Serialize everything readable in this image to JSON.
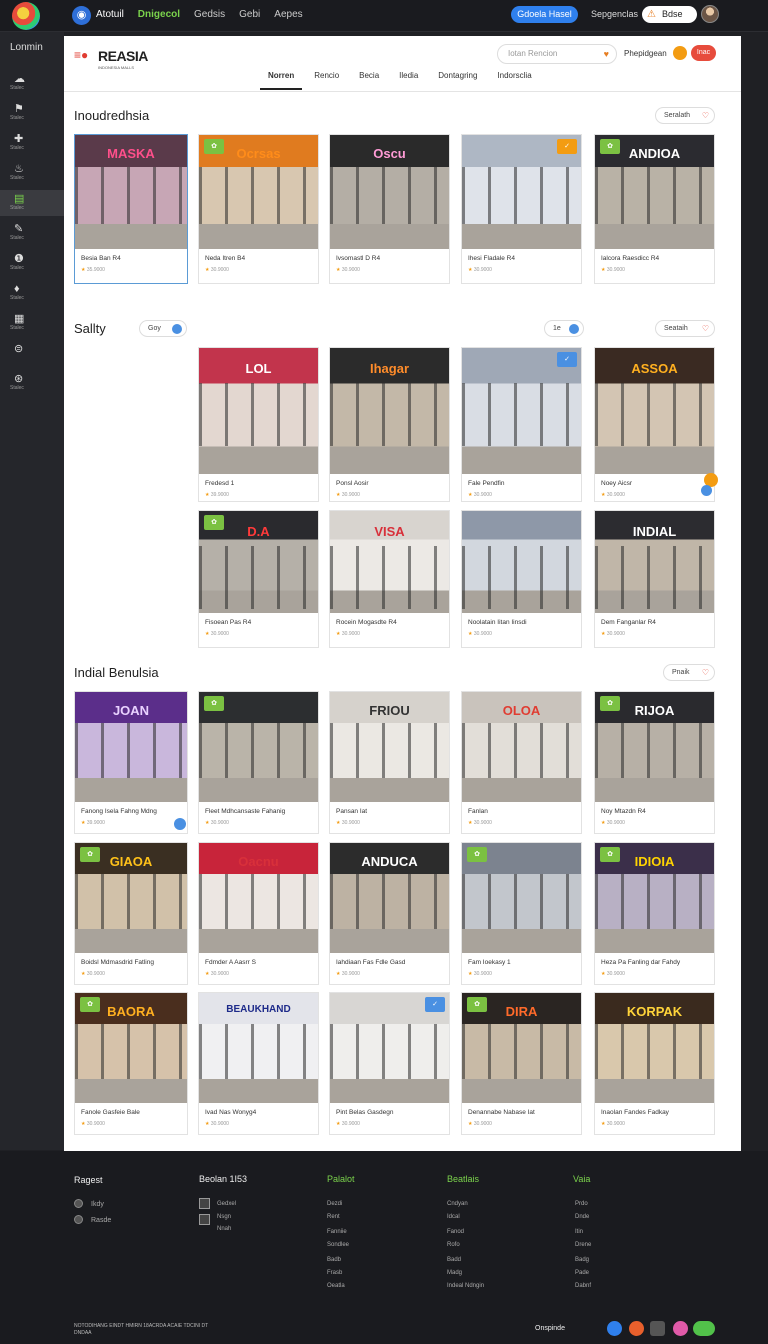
{
  "topbar": {
    "nav": [
      "Atotuil",
      "Dnigecol",
      "Gedsis",
      "Gebi",
      "Aepes"
    ],
    "active_index": 1,
    "cta": "Gdoela Hasel",
    "link": "Sepgenclas",
    "account": "Bdse"
  },
  "sidebar": {
    "title": "Lonmin",
    "items": [
      {
        "icon": "☁",
        "label": "Stalec"
      },
      {
        "icon": "⚑",
        "label": "Stalec"
      },
      {
        "icon": "✚",
        "label": "Stalec"
      },
      {
        "icon": "♨",
        "label": "Stalec"
      },
      {
        "icon": "▤",
        "label": "Stalec"
      },
      {
        "icon": "✎",
        "label": "Stalec"
      },
      {
        "icon": "❶",
        "label": "Stalec"
      },
      {
        "icon": "♦",
        "label": "Stalec"
      },
      {
        "icon": "▦",
        "label": "Stalec"
      },
      {
        "icon": "⊜",
        "label": ""
      },
      {
        "icon": "⊛",
        "label": "Stalec"
      }
    ],
    "active_index": 4
  },
  "header": {
    "brand": "REASIA",
    "brand_tagline": "INDONESIA MALLS",
    "search_placeholder": "Iotan Rencion",
    "link": "Phepidgean",
    "button": "Inac",
    "tabs": [
      "Norren",
      "Rencio",
      "Becia",
      "Iledia",
      "Dontagring",
      "Indorsclia"
    ],
    "active_tab": 0
  },
  "sections": [
    {
      "title": "Inoudredhsia",
      "pill": "Seralath",
      "cards": [
        {
          "title": "Besia Ban R4",
          "sub": "35.9000",
          "sign": "MASKA",
          "sign_color": "#ff4f8b",
          "colors": [
            "#5a3a4a",
            "#c7a6b5"
          ],
          "badge": ""
        },
        {
          "title": "Neda Itren B4",
          "sub": "30.9000",
          "sign": "Ocrsas",
          "sign_color": "#ff8c1a",
          "colors": [
            "#e07b1f",
            "#d8c7b0"
          ],
          "badge": "g"
        },
        {
          "title": "Ivsomastl D R4",
          "sub": "30.9000",
          "sign": "Oscu",
          "sign_color": "#ff9bd6",
          "colors": [
            "#2a2a2a",
            "#b4aea5"
          ],
          "badge": ""
        },
        {
          "title": "Ihesi Fladale R4",
          "sub": "30.9000",
          "sign": "",
          "sign_color": "#fff",
          "colors": [
            "#aeb7c4",
            "#dfe3ea"
          ],
          "badge": "o"
        },
        {
          "title": "Ialcora Raesdicc R4",
          "sub": "30.9000",
          "sign": "ANDIOA",
          "sign_color": "#ffffff",
          "colors": [
            "#2b2b30",
            "#b9b2a6"
          ],
          "badge": "g"
        }
      ]
    },
    {
      "title": "Sallty",
      "pill_left": "Goy",
      "pill_mid": "1e",
      "pill": "Seataih",
      "cards": [
        {
          "title": "Fredesd 1",
          "sub": "39.9000",
          "sign": "LOL",
          "sign_color": "#ffffff",
          "colors": [
            "#c2344c",
            "#e3d7d0"
          ],
          "badge": ""
        },
        {
          "title": "Ponsl Aosir",
          "sub": "30.9000",
          "sign": "Ihagar",
          "sign_color": "#ff8c2a",
          "colors": [
            "#2b2b2b",
            "#c3b8a8"
          ],
          "badge": ""
        },
        {
          "title": "Fale Pendfin",
          "sub": "30.9000",
          "sign": "",
          "sign_color": "#fff",
          "colors": [
            "#9fa8b6",
            "#d9dde4"
          ],
          "badge": "b"
        },
        {
          "title": "Noey Aicsr",
          "sub": "30.9000",
          "sign": "ASSOA",
          "sign_color": "#ffb020",
          "colors": [
            "#3a2a22",
            "#d3c5b3"
          ],
          "badge": ""
        },
        {
          "title": "Fisoean Pas R4",
          "sub": "30.9000",
          "sign": "D.A",
          "sign_color": "#ff3a3a",
          "colors": [
            "#2a2a2e",
            "#b5b0a8"
          ],
          "badge": "g"
        },
        {
          "title": "Rocein Mogasdte R4",
          "sub": "30.9000",
          "sign": "VISA",
          "sign_color": "#d8303a",
          "colors": [
            "#d8d4cf",
            "#ece9e5"
          ],
          "badge": ""
        },
        {
          "title": "Noolatain Iitan Iinsdi",
          "sub": "30.9000",
          "sign": "",
          "sign_color": "#fff",
          "colors": [
            "#8e98a8",
            "#d2d7de"
          ],
          "badge": ""
        },
        {
          "title": "Dem Fanganlar R4",
          "sub": "30.9000",
          "sign": "INDIAL",
          "sign_color": "#ffffff",
          "colors": [
            "#2c2c30",
            "#c0b6a8"
          ],
          "badge": ""
        }
      ]
    },
    {
      "title": "Indial Benulsia",
      "pill": "Pnaik",
      "cards": [
        {
          "title": "Fanong Isela Fahng Mdng",
          "sub": "39.9000",
          "sign": "JOAN",
          "sign_color": "#e9d2ff",
          "colors": [
            "#5b2e8a",
            "#c9b7dc"
          ],
          "badge": ""
        },
        {
          "title": "Fleet Mdhcansaste Fahanig",
          "sub": "30.9000",
          "sign": "",
          "sign_color": "#fff",
          "colors": [
            "#2c2e30",
            "#bab4a9"
          ],
          "badge": "g"
        },
        {
          "title": "Pansan Iat",
          "sub": "30.9000",
          "sign": "FRIOU",
          "sign_color": "#333333",
          "colors": [
            "#d6d2cc",
            "#ebe8e3"
          ],
          "badge": ""
        },
        {
          "title": "Fanlan",
          "sub": "30.9000",
          "sign": "OLOA",
          "sign_color": "#e03c31",
          "colors": [
            "#c9c3bc",
            "#e2ded8"
          ],
          "badge": ""
        },
        {
          "title": "Noy Mtazdn R4",
          "sub": "30.9000",
          "sign": "RIJOA",
          "sign_color": "#ffffff",
          "colors": [
            "#2a2a2e",
            "#b7b0a6"
          ],
          "badge": "g"
        },
        {
          "title": "Boidsl Mdmasdrid Fatling",
          "sub": "30.9000",
          "sign": "GIAOA",
          "sign_color": "#ffc21a",
          "colors": [
            "#3a2f22",
            "#d1c1a9"
          ],
          "badge": "g"
        },
        {
          "title": "Fdmder A Aasrr S",
          "sub": "30.9000",
          "sign": "Oacnu",
          "sign_color": "#d8303a",
          "colors": [
            "#c8243a",
            "#ece6e2"
          ],
          "badge": ""
        },
        {
          "title": "Iahdiaan Fas Fdle Gasd",
          "sub": "30.9000",
          "sign": "ANDUCA",
          "sign_color": "#ffffff",
          "colors": [
            "#2c2c2c",
            "#bdb2a3"
          ],
          "badge": ""
        },
        {
          "title": "Fam Ioekasy 1",
          "sub": "30.9000",
          "sign": "",
          "sign_color": "#fff",
          "colors": [
            "#7c838f",
            "#c2c6cc"
          ],
          "badge": "g"
        },
        {
          "title": "Heza Pa Fanling dar Fahdy",
          "sub": "30.9000",
          "sign": "IDIOIA",
          "sign_color": "#ffd400",
          "colors": [
            "#3b2f4a",
            "#b8b0c4"
          ],
          "badge": "g"
        },
        {
          "title": "Fanole Gasfeie Bale",
          "sub": "30.9000",
          "sign": "BAORA",
          "sign_color": "#ffb020",
          "colors": [
            "#4a2e1e",
            "#d6c2aa"
          ],
          "badge": "g"
        },
        {
          "title": "Ivad Nas Wonyg4",
          "sub": "30.9000",
          "sign": "BEAUKHAND",
          "sign_color": "#1e2b8a",
          "colors": [
            "#e3e4ea",
            "#f0f0f2"
          ],
          "badge": ""
        },
        {
          "title": "Pint Belas Gasdegn",
          "sub": "30.9000",
          "sign": "",
          "sign_color": "#333",
          "colors": [
            "#d8d6d3",
            "#efeeec"
          ],
          "badge": "b"
        },
        {
          "title": "Denannabe Nabase Iat",
          "sub": "30.9000",
          "sign": "DIRA",
          "sign_color": "#ff6a2a",
          "colors": [
            "#2a2522",
            "#c8baa6"
          ],
          "badge": "g"
        },
        {
          "title": "Inaolan Fandes Fadkay",
          "sub": "30.9000",
          "sign": "KORPAK",
          "sign_color": "#ffd43a",
          "colors": [
            "#3a2a1e",
            "#d9c8ac"
          ],
          "badge": ""
        }
      ]
    }
  ],
  "footer": {
    "col1": {
      "title": "Ragest",
      "items": [
        "Ikdy",
        "Rasde"
      ]
    },
    "col2": {
      "title": "Beolan 1I53",
      "items": [
        "Gedxel",
        "Nsgn",
        "Nnah"
      ]
    },
    "col3": {
      "title": "Palalot",
      "items": [
        "Dezdi",
        "Rent",
        "Fanniie",
        "Sondlee",
        "Badb",
        "Frasb",
        "Oeatla"
      ]
    },
    "col4": {
      "title": "Beatlais",
      "items": [
        "Cndyan",
        "Idcal",
        "Fanod",
        "Rofo",
        "Badd",
        "Madg",
        "Indeal Ndngin"
      ]
    },
    "col5": {
      "title": "Vaia",
      "items": [
        "Prdo",
        "Dnde",
        "Itin",
        "Drene",
        "Badg",
        "Pade",
        "Dabnf"
      ]
    },
    "copyright": "NOTODIHANG EINDT HMIRN 18ACRDA ACAIE TDCINI DT DNDAA",
    "social_label": "Onspinde"
  }
}
